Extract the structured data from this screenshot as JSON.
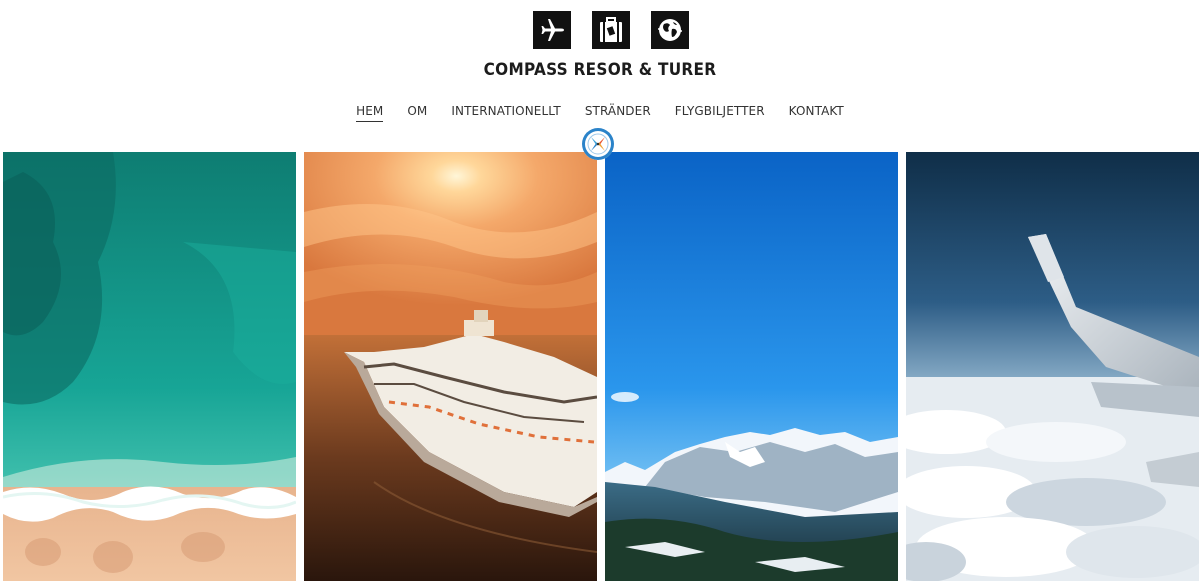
{
  "header": {
    "logo_icons": [
      "airplane-icon",
      "suitcase-icon",
      "globe-icon"
    ],
    "brand": "COMPASS RESOR & TURER"
  },
  "nav": {
    "items": [
      {
        "label": "HEM",
        "active": true
      },
      {
        "label": "OM",
        "active": false
      },
      {
        "label": "INTERNATIONELLT",
        "active": false
      },
      {
        "label": "STRÄNDER",
        "active": false
      },
      {
        "label": "FLYGBILJETTER",
        "active": false
      },
      {
        "label": "KONTAKT",
        "active": false
      }
    ]
  },
  "badge": {
    "icon": "compass-icon",
    "ring_color": "#2b83c9"
  },
  "gallery": {
    "panels": [
      {
        "name": "beach-aerial-photo"
      },
      {
        "name": "cruise-ship-sunset-photo"
      },
      {
        "name": "snowy-mountains-photo"
      },
      {
        "name": "airplane-wing-clouds-photo"
      }
    ]
  }
}
